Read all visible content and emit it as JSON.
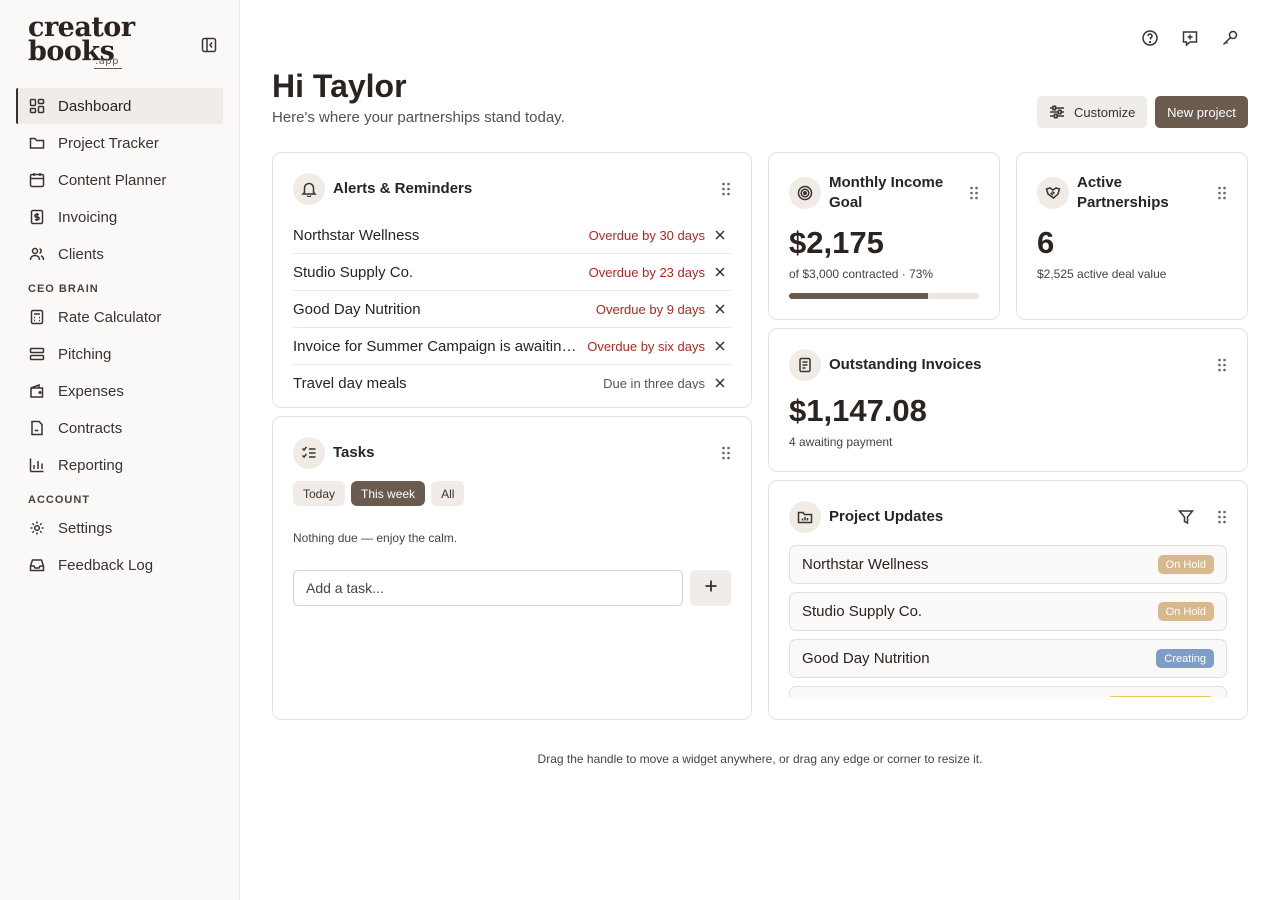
{
  "brand": {
    "line1": "creator",
    "line2": "books",
    "suffix": ".app"
  },
  "sidebar": {
    "items": [
      {
        "label": "Dashboard",
        "icon": "grid-icon",
        "active": true
      },
      {
        "label": "Project Tracker",
        "icon": "folder-icon"
      },
      {
        "label": "Content Planner",
        "icon": "calendar-icon"
      },
      {
        "label": "Invoicing",
        "icon": "dollar-icon"
      },
      {
        "label": "Clients",
        "icon": "users-icon"
      }
    ],
    "section_ceo": "CEO BRAIN",
    "ceo_items": [
      {
        "label": "Rate Calculator",
        "icon": "calculator-icon"
      },
      {
        "label": "Pitching",
        "icon": "stack-icon"
      },
      {
        "label": "Expenses",
        "icon": "wallet-icon"
      },
      {
        "label": "Contracts",
        "icon": "document-icon"
      },
      {
        "label": "Reporting",
        "icon": "bar-chart-icon"
      }
    ],
    "section_account": "ACCOUNT",
    "account_items": [
      {
        "label": "Settings",
        "icon": "gear-icon"
      },
      {
        "label": "Feedback Log",
        "icon": "inbox-icon"
      }
    ]
  },
  "header": {
    "greeting": "Hi Taylor",
    "subtitle": "Here's where your partnerships stand today.",
    "customize_label": "Customize",
    "new_project_label": "New project"
  },
  "alerts": {
    "title": "Alerts & Reminders",
    "items": [
      {
        "name": "Northstar Wellness",
        "due": "Overdue by 30 days",
        "overdue": true
      },
      {
        "name": "Studio Supply Co.",
        "due": "Overdue by 23 days",
        "overdue": true
      },
      {
        "name": "Good Day Nutrition",
        "due": "Overdue by 9 days",
        "overdue": true
      },
      {
        "name": "Invoice for Summer Campaign is awaiting payment",
        "due": "Overdue by six days",
        "overdue": true
      },
      {
        "name": "Travel day meals",
        "due": "Due in three days",
        "overdue": false
      }
    ]
  },
  "tasks": {
    "title": "Tasks",
    "filters": [
      {
        "label": "Today",
        "active": false
      },
      {
        "label": "This week",
        "active": true
      },
      {
        "label": "All",
        "active": false
      }
    ],
    "empty_text": "Nothing due — enjoy the calm.",
    "input_placeholder": "Add a task..."
  },
  "income": {
    "title": "Monthly Income Goal",
    "amount": "$2,175",
    "caption": "of $3,000 contracted · 73%",
    "progress": 0.73
  },
  "partnerships": {
    "title": "Active Partnerships",
    "count": "6",
    "caption": "$2,525 active deal value"
  },
  "outstanding": {
    "title": "Outstanding Invoices",
    "amount": "$1,147.08",
    "caption": "4 awaiting payment"
  },
  "projects": {
    "title": "Project Updates",
    "items": [
      {
        "name": "Northstar Wellness",
        "status": "On Hold",
        "color": "#d8b98e"
      },
      {
        "name": "Studio Supply Co.",
        "status": "On Hold",
        "color": "#d8b98e"
      },
      {
        "name": "Good Day Nutrition",
        "status": "Creating",
        "color": "#7f9ec7"
      },
      {
        "name": "",
        "status": "",
        "color": "#e7c85a"
      }
    ]
  },
  "hint": "Drag the handle to move a widget anywhere, or drag any edge or corner to resize it."
}
